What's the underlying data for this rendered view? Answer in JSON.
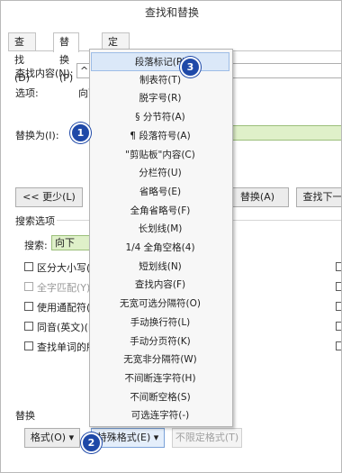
{
  "window": {
    "title": "查找和替换"
  },
  "tabs": [
    {
      "label": "查找(D)"
    },
    {
      "label": "替换(P)"
    },
    {
      "label": "定位(G)"
    }
  ],
  "form": {
    "find_label": "查找内容(N):",
    "find_value": "^l",
    "options_label": "选项:",
    "options_value": "向下",
    "replace_label": "替换为(I):",
    "replace_value": ""
  },
  "buttons": {
    "less": "<< 更少(L)",
    "replace": "替换(A)",
    "find_next": "查找下一处"
  },
  "search_options": {
    "heading": "搜索选项",
    "search_label": "搜索:",
    "search_value": "向下",
    "checkboxes": [
      {
        "label": "区分大小写(H)",
        "disabled": false
      },
      {
        "label": "全字匹配(Y)",
        "disabled": true
      },
      {
        "label": "使用通配符(U)",
        "disabled": false
      },
      {
        "label": "同音(英文)(K)",
        "disabled": false
      },
      {
        "label": "查找单词的所有形式",
        "disabled": false
      }
    ]
  },
  "replace_section": {
    "heading": "替换",
    "format_button": "格式(O) ▾",
    "special_button": "特殊格式(E) ▾",
    "no_format_button": "不限定格式(T)"
  },
  "special_menu": {
    "items": [
      "段落标记(P)",
      "制表符(T)",
      "脱字号(R)",
      "§ 分节符(A)",
      "¶ 段落符号(A)",
      "\"剪贴板\"内容(C)",
      "分栏符(U)",
      "省略号(E)",
      "全角省略号(F)",
      "长划线(M)",
      "1/4 全角空格(4)",
      "短划线(N)",
      "查找内容(F)",
      "无宽可选分隔符(O)",
      "手动换行符(L)",
      "手动分页符(K)",
      "无宽非分隔符(W)",
      "不间断连字符(H)",
      "不间断空格(S)",
      "可选连字符(-)"
    ],
    "highlighted_index": 0
  },
  "badges": [
    "1",
    "2",
    "3"
  ]
}
